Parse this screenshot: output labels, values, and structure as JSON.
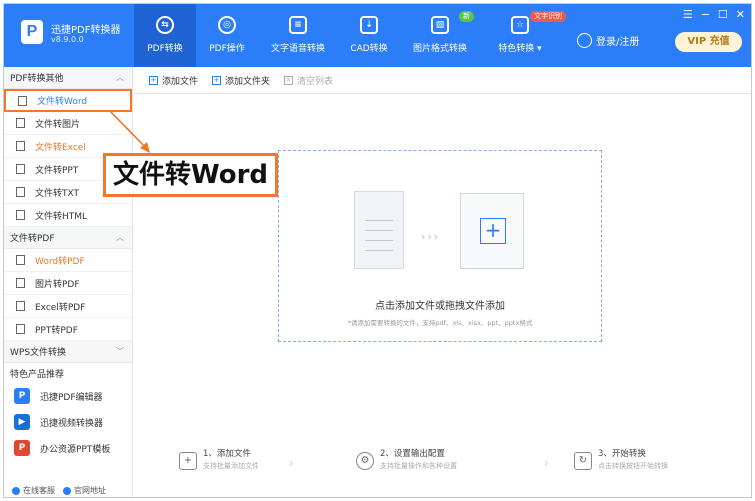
{
  "app": {
    "logo_letter": "P",
    "name": "迅捷PDF转换器",
    "version": "v8.9.0.0"
  },
  "nav": [
    {
      "label": "PDF转换",
      "icon": "pdf-convert-icon",
      "glyph": "⇆",
      "active": true
    },
    {
      "label": "PDF操作",
      "icon": "pdf-operate-icon",
      "glyph": "◎",
      "active": false
    },
    {
      "label": "文字语音转换",
      "icon": "speech-icon",
      "glyph": "≡",
      "active": false
    },
    {
      "label": "CAD转换",
      "icon": "cad-icon",
      "glyph": "⇣",
      "active": false
    },
    {
      "label": "图片格式转换",
      "icon": "image-icon",
      "glyph": "▨",
      "active": false,
      "badge": "新"
    },
    {
      "label": "特色转换 ▾",
      "icon": "special-icon",
      "glyph": "☆",
      "active": false,
      "badge": "文字识别"
    }
  ],
  "window_buttons": [
    "☰",
    "−",
    "☐",
    "✕"
  ],
  "login_label": "登录/注册",
  "vip_label": "VIP 充值",
  "sidebar": {
    "section1": "PDF转换其他",
    "section1_items": [
      "文件转Word",
      "文件转图片",
      "文件转Excel",
      "文件转PPT",
      "文件转TXT",
      "文件转HTML"
    ],
    "section2": "文件转PDF",
    "section2_items": [
      "Word转PDF",
      "图片转PDF",
      "Excel转PDF",
      "PPT转PDF"
    ],
    "section3": "WPS文件转换",
    "promo_title": "特色产品推荐",
    "promo_items": [
      "迅捷PDF编辑器",
      "迅捷视频转换器",
      "办公资源PPT模板"
    ],
    "online_service": "在线客服",
    "website": "官网地址"
  },
  "toolbar": {
    "add_file": "添加文件",
    "add_folder": "添加文件夹",
    "clear_list": "清空列表"
  },
  "drop": {
    "title": "点击添加文件或拖拽文件添加",
    "hint": "*请添加需要转换的文件，支持pdf、xls、xlsx、ppt、pptx格式"
  },
  "steps": [
    {
      "title": "1、添加文件",
      "desc": "支持批量添加文件"
    },
    {
      "title": "2、设置输出配置",
      "desc": "支持批量操作和各种设置"
    },
    {
      "title": "3、开始转换",
      "desc": "点击转换按钮开始转换"
    }
  ],
  "callout_text": "文件转Word",
  "colors": {
    "primary": "#2c7ef8",
    "accent": "#f0772c",
    "vip": "#b07a1c"
  }
}
